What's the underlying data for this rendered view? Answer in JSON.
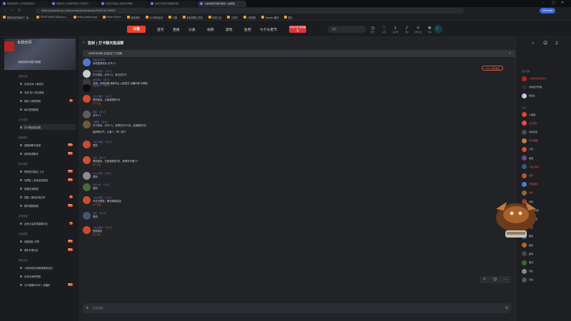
{
  "browser": {
    "tabs": [
      {
        "label": "我最新鲜真_hp手机游戏发布…"
      },
      {
        "label": "游戏世界_全球游戏新闻_手游资讯"
      },
      {
        "label": "永劫无间最新_永劫无间攻略"
      },
      {
        "label": "永劫无间新手攻略和详解"
      },
      {
        "label": "斗鱼永劫无间官方频道 斗鱼频道"
      }
    ],
    "url": "https://www.douyu.com/creator/#/clanboard/100073/100000",
    "profile_label": "InPrivate",
    "bookmarks": [
      "搜狐欢迎您使用了_游...",
      "TKTKTTKSKTK @douyu...",
      "https://www.w.gg",
      "Maker Playrs",
      "自搜视频",
      "423体验活动",
      "中路",
      "我的收藏工具条",
      "影视工具",
      "工具外",
      "5游视频",
      "Google 翻译",
      "图片"
    ]
  },
  "site_nav": {
    "logo": "斗鱼",
    "links": [
      "首页",
      "直播",
      "分类",
      "视频",
      "游戏",
      "鱼吧",
      "今夕长夏节"
    ],
    "promo": "年中大促 鱼吧福利",
    "search_placeholder": "搜索",
    "icons": [
      {
        "label": "历史",
        "icon": "history-icon"
      },
      {
        "label": "关注",
        "icon": "heart-icon"
      },
      {
        "label": "客户端",
        "icon": "download-icon"
      },
      {
        "label": "消息",
        "icon": "bell-icon"
      },
      {
        "label": "创作中心",
        "icon": "bulb-icon"
      },
      {
        "label": "活动",
        "icon": "gift-icon"
      }
    ]
  },
  "sidebar": {
    "game_title": "永劫无间",
    "banner_line": "斗鱼永劫无间官方频道",
    "sections": [
      {
        "title": "频道信息",
        "items": [
          {
            "label": "永劫无间 斗鱼官方",
            "badge": ""
          },
          {
            "label": "乐蒙·双人领主频道",
            "badge": ""
          },
          {
            "label": "规则 | 新规须知",
            "badge": "1"
          },
          {
            "label": "每日签到频道",
            "badge": ""
          }
        ]
      },
      {
        "title": "打卡频道",
        "items": [
          {
            "label": "打卡聊天挑战赛",
            "badge": "",
            "active": true
          }
        ]
      },
      {
        "title": "频道聊天",
        "items": [
          {
            "label": "直播间聊天频道",
            "badge": "99+"
          },
          {
            "label": "鱼吧精选聊天",
            "badge": "99+"
          }
        ]
      },
      {
        "title": "新手指导",
        "items": [
          {
            "label": "转职技巧建议 上分",
            "badge": "99+"
          },
          {
            "label": "吐槽区 | 游戏反馈频道",
            "badge": "99+"
          },
          {
            "label": "攻略交流频道",
            "badge": ""
          },
          {
            "label": "捏脸 | 角色外观分享",
            "badge": "1"
          },
          {
            "label": "教学视频频道",
            "badge": "99+"
          }
        ]
      },
      {
        "title": "赛事频道",
        "items": [
          {
            "label": "武道大会赛事直播讨论",
            "badge": "1"
          }
        ]
      },
      {
        "title": "互动频道",
        "items": [
          {
            "label": "招募组队 开黑",
            "badge": "99+"
          },
          {
            "label": "周末开黑大队",
            "badge": "99+"
          }
        ]
      },
      {
        "title": "频道活动",
        "items": [
          {
            "label": "斗鱼永劫无间频道最新活动",
            "badge": ""
          },
          {
            "label": "永劫无间杯联赛",
            "badge": ""
          },
          {
            "label": "元气满满冲冲冲 | 领福利",
            "badge": "99+"
          }
        ]
      }
    ]
  },
  "chat": {
    "title": "签到 | 打卡聊天挑战赛",
    "notice": "永劫升阶攻略 欢迎前往下方查看",
    "pill": "100+ 条新消息",
    "messages": [
      {
        "name": "永劫无间官方",
        "time": "",
        "text": "永劫签到成功 元气+1",
        "flair": ""
      },
      {
        "name": "打卡小助手",
        "time": "6月1日",
        "text": "打卡成功，元气+2，本日已打卡",
        "flair": ""
      },
      {
        "name": "永劫玩家",
        "time": "6月2日",
        "text": "五湖：永劫四海 西域中山 山河四方 北疆中原 中原篇",
        "flair": ""
      },
      {
        "name": "无尘落叶",
        "time": "6月2日",
        "text": "",
        "flair": ""
      },
      {
        "name": "斗鱼小精灵",
        "time": "6月2日",
        "text": "签到成功，已连续签到2天",
        "flair": "新人乐园"
      },
      {
        "name": "暗夜",
        "time": "6月2日",
        "text": "元气+1",
        "flair": ""
      },
      {
        "name": "小狐狸",
        "time": "6月3日",
        "text": "打卡成功，元气+1，本周已打卡5次，连续签到3天",
        "flair": ""
      },
      {
        "name": "",
        "time": "",
        "text": "晨间有元气，斗鱼人，你一定行",
        "flair": ""
      },
      {
        "name": "斗鱼小精灵",
        "time": "6月3日",
        "text": "签到",
        "flair": ""
      },
      {
        "name": "大圣",
        "time": "6月3日",
        "text": "签到成功，已连续签到3天，获得元气值+5",
        "flair": "新人乐园"
      },
      {
        "name": "Cerry风铃",
        "time": "6月4日",
        "text": "签到",
        "flair": ""
      },
      {
        "name": "玩家小龙",
        "time": "6月4日",
        "text": "签到",
        "flair": ""
      },
      {
        "name": "斗鱼小精灵",
        "time": "6月4日",
        "text": "今日已签到，明天继续加油",
        "flair": "新人乐园"
      },
      {
        "name": "玩家",
        "time": "6月4日",
        "text": "签到",
        "flair": ""
      },
      {
        "name": "斗鱼小精灵",
        "time": "6月4日",
        "text": "签到成功",
        "flair": "新人乐园"
      }
    ],
    "input_placeholder": "发送消息"
  },
  "members": {
    "sections": [
      {
        "title": "频道管理",
        "names": [
          {
            "name": "斗鱼永劫无间官方",
            "color": "red"
          },
          {
            "name": "永劫官方管理",
            "color": ""
          },
          {
            "name": "频道主",
            "color": ""
          }
        ]
      },
      {
        "title": "在线",
        "names": [
          {
            "name": "小狐狸",
            "color": ""
          },
          {
            "name": "无尘落叶",
            "color": "red"
          },
          {
            "name": "永劫玩家",
            "color": ""
          },
          {
            "name": "元气满满",
            "color": "pink"
          },
          {
            "name": "大圣",
            "color": ""
          },
          {
            "name": "暗夜",
            "color": ""
          },
          {
            "name": "斗鱼小精灵",
            "color": "red"
          },
          {
            "name": "夜雨",
            "color": "red"
          },
          {
            "name": "永劫萌新",
            "color": "red"
          },
          {
            "name": "冰封",
            "color": "red"
          },
          {
            "name": "清风",
            "color": ""
          },
          {
            "name": "Cerry风铃",
            "color": ""
          },
          {
            "name": "玩家小龙",
            "color": ""
          },
          {
            "name": "行云",
            "color": ""
          },
          {
            "name": "暮色",
            "color": ""
          },
          {
            "name": "破晓",
            "color": ""
          },
          {
            "name": "星河",
            "color": ""
          },
          {
            "name": "明月",
            "color": ""
          },
          {
            "name": "浮生",
            "color": ""
          },
          {
            "name": "归途",
            "color": ""
          }
        ]
      }
    ]
  },
  "colors": {
    "accent": "#e8442d",
    "link": "#5c8cf0",
    "username": "#6a74c8",
    "flair": "#d84c2a"
  }
}
